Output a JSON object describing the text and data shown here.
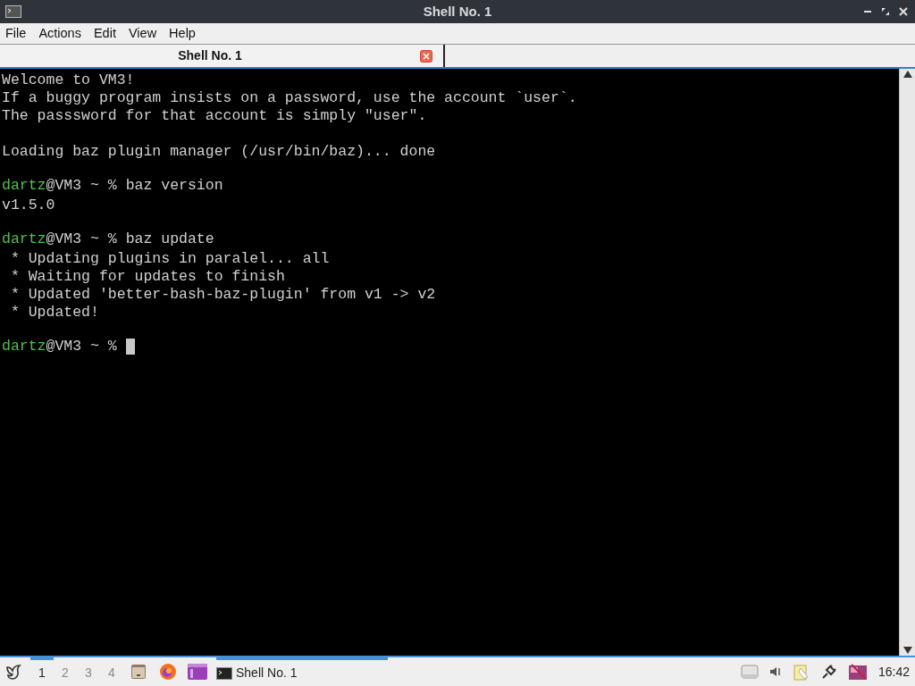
{
  "window": {
    "title": "Shell No. 1"
  },
  "menu": [
    "File",
    "Actions",
    "Edit",
    "View",
    "Help"
  ],
  "tabs": [
    {
      "label": "Shell No. 1",
      "selected": true
    }
  ],
  "terminal": {
    "lines": [
      {
        "kind": "text",
        "text": "Welcome to VM3!"
      },
      {
        "kind": "text",
        "text": "If a buggy program insists on a password, use the account `user`."
      },
      {
        "kind": "text",
        "text": "The passsword for that account is simply \"user\"."
      },
      {
        "kind": "blank"
      },
      {
        "kind": "text",
        "text": "Loading baz plugin manager (/usr/bin/baz)... done"
      },
      {
        "kind": "blank"
      },
      {
        "kind": "prompt",
        "user": "dartz",
        "host": "@VM3 ~ %",
        "command": "baz version"
      },
      {
        "kind": "text",
        "text": "v1.5.0"
      },
      {
        "kind": "blank"
      },
      {
        "kind": "prompt",
        "user": "dartz",
        "host": "@VM3 ~ %",
        "command": "baz update"
      },
      {
        "kind": "text",
        "text": " * Updating plugins in paralel... all"
      },
      {
        "kind": "text",
        "text": " * Waiting for updates to finish"
      },
      {
        "kind": "text",
        "text": " * Updated 'better-bash-baz-plugin' from v1 -> v2"
      },
      {
        "kind": "text",
        "text": " * Updated!"
      },
      {
        "kind": "blank"
      },
      {
        "kind": "prompt",
        "user": "dartz",
        "host": "@VM3 ~ %",
        "cursor": true
      }
    ]
  },
  "taskbar": {
    "workspaces": [
      {
        "label": "1",
        "selected": true
      },
      {
        "label": "2",
        "selected": false
      },
      {
        "label": "3",
        "selected": false
      },
      {
        "label": "4",
        "selected": false
      }
    ],
    "tasks": [
      {
        "label": "Shell No. 1",
        "selected": true
      }
    ],
    "clock": "16:42"
  }
}
